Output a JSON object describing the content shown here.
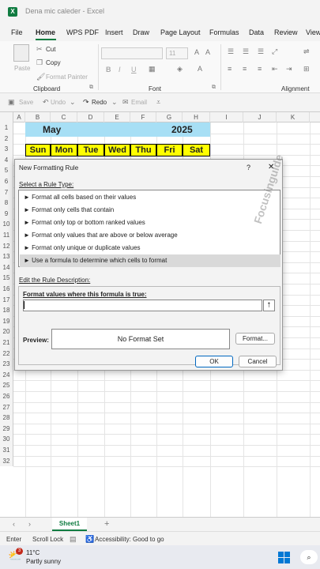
{
  "window": {
    "title": "Dena mic caleder - Excel",
    "logo": "X"
  },
  "menu": {
    "items": [
      "File",
      "Home",
      "WPS PDF",
      "Insert",
      "Draw",
      "Page Layout",
      "Formulas",
      "Data",
      "Review",
      "View"
    ]
  },
  "ribbon": {
    "paste": "Paste",
    "cut": "Cut",
    "copy": "Copy",
    "format_painter": "Format Painter",
    "clipboard": "Clipboard",
    "font_size": "11",
    "bold": "B",
    "italic": "I",
    "underline": "U",
    "font": "Font",
    "alignment": "Alignment"
  },
  "qat": {
    "save": "Save",
    "undo": "Undo",
    "redo": "Redo",
    "email": "Email"
  },
  "grid": {
    "columns": [
      "A",
      "B",
      "C",
      "D",
      "E",
      "F",
      "G",
      "H",
      "I",
      "J",
      "K"
    ],
    "rows": [
      "1",
      "2",
      "3",
      "4",
      "5",
      "6",
      "7",
      "8",
      "9",
      "10",
      "11",
      "12",
      "13",
      "14",
      "15",
      "16",
      "17",
      "18",
      "19",
      "20",
      "21",
      "22",
      "23",
      "24",
      "25",
      "26",
      "27",
      "28",
      "29",
      "30",
      "31",
      "32"
    ],
    "month": "May",
    "year": "2025",
    "days": [
      "Sun",
      "Mon",
      "Tue",
      "Wed",
      "Thu",
      "Fri",
      "Sat"
    ]
  },
  "dialog": {
    "title": "New Formatting Rule",
    "help": "?",
    "close": "✕",
    "select_label": "Select a Rule Type:",
    "rules": [
      "► Format all cells based on their values",
      "► Format only cells that contain",
      "► Format only top or bottom ranked values",
      "► Format only values that are above or below average",
      "► Format only unique or duplicate values",
      "► Use a formula to determine which cells to format"
    ],
    "edit_label": "Edit the Rule Description:",
    "formula_label": "Format values where this formula is true:",
    "formula_value": "",
    "preview_label": "Preview:",
    "preview_text": "No Format Set",
    "format_btn": "Format...",
    "ok": "OK",
    "cancel": "Cancel"
  },
  "sheet": {
    "tab": "Sheet1",
    "add": "+"
  },
  "status": {
    "mode": "Enter",
    "scroll_lock": "Scroll Lock",
    "accessibility": "Accessibility: Good to go"
  },
  "taskbar": {
    "temp": "11°C",
    "weather": "Partly sunny",
    "badge": "3"
  },
  "watermark": "Focusinguide",
  "colors": {
    "excel_green": "#107c41",
    "calendar_header": "#a7dff5",
    "day_header": "#ffff00"
  }
}
